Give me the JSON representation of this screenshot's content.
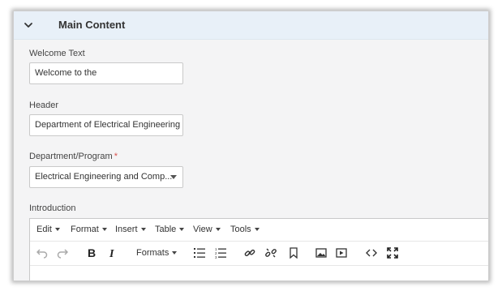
{
  "panel": {
    "title": "Main Content",
    "expanded": true
  },
  "fields": {
    "welcome": {
      "label": "Welcome Text",
      "value": "Welcome to the"
    },
    "header": {
      "label": "Header",
      "value": "Department of Electrical Engineering"
    },
    "department": {
      "label": "Department/Program",
      "required_mark": "*",
      "value": "Electrical Engineering and Comp..."
    },
    "introduction": {
      "label": "Introduction"
    }
  },
  "editor": {
    "menu": [
      "Edit",
      "Format",
      "Insert",
      "Table",
      "View",
      "Tools"
    ],
    "formats_label": "Formats",
    "toolbar_icons": [
      "undo-icon",
      "redo-icon",
      "bold-icon",
      "italic-icon",
      "formats-dropdown",
      "bullet-list-icon",
      "numbered-list-icon",
      "link-icon",
      "unlink-icon",
      "bookmark-icon",
      "image-icon",
      "media-icon",
      "code-icon",
      "fullscreen-icon"
    ]
  },
  "colors": {
    "header_bg": "#e8f0f8",
    "required": "#d9534f",
    "panel_bg": "#f4f4f5"
  }
}
